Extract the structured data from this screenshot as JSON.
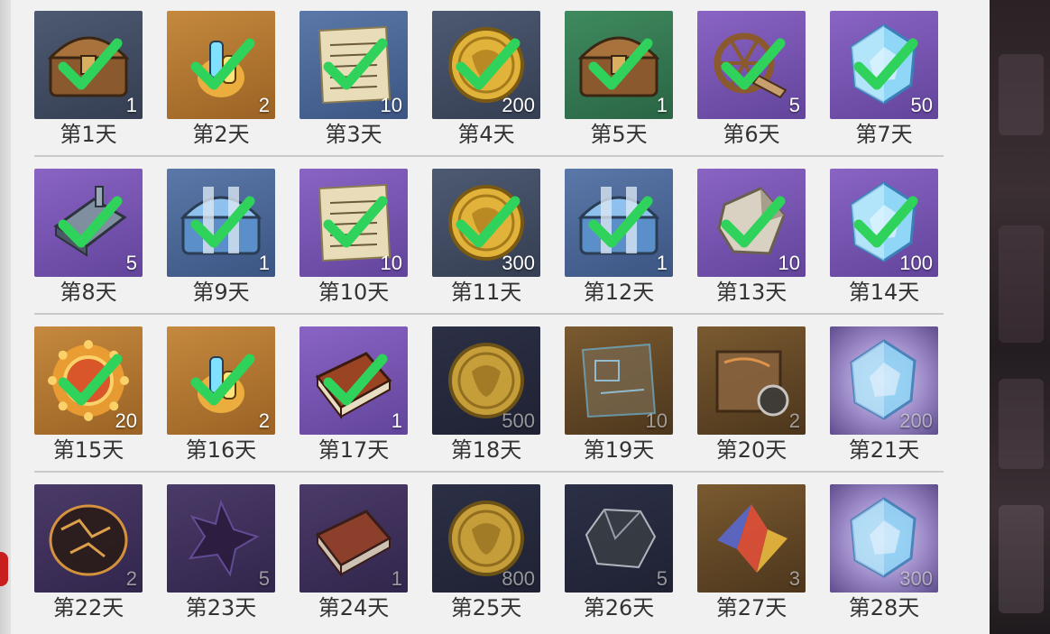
{
  "colors": {
    "check": "#2fd25a",
    "panel": "#f1f1f1",
    "label": "#333333"
  },
  "days": [
    {
      "label": "第1天",
      "qty": "1",
      "item_icon": "chest-icon",
      "bg": "dark",
      "claimed": true
    },
    {
      "label": "第2天",
      "qty": "2",
      "item_icon": "potion-bottles-icon",
      "bg": "orange",
      "claimed": true
    },
    {
      "label": "第3天",
      "qty": "10",
      "item_icon": "scroll-page-icon",
      "bg": "blue",
      "claimed": true
    },
    {
      "label": "第4天",
      "qty": "200",
      "item_icon": "gold-coin-icon",
      "bg": "dark",
      "claimed": true
    },
    {
      "label": "第5天",
      "qty": "1",
      "item_icon": "chest-icon",
      "bg": "green",
      "claimed": true
    },
    {
      "label": "第6天",
      "qty": "5",
      "item_icon": "wheel-part-icon",
      "bg": "purple",
      "claimed": true
    },
    {
      "label": "第7天",
      "qty": "50",
      "item_icon": "blue-crystal-icon",
      "bg": "purple",
      "claimed": true
    },
    {
      "label": "第8天",
      "qty": "5",
      "item_icon": "metal-ingot-icon",
      "bg": "purple",
      "claimed": true
    },
    {
      "label": "第9天",
      "qty": "1",
      "item_icon": "blue-chest-icon",
      "bg": "blue",
      "claimed": true
    },
    {
      "label": "第10天",
      "qty": "10",
      "item_icon": "scroll-page-icon",
      "bg": "purple",
      "claimed": true
    },
    {
      "label": "第11天",
      "qty": "300",
      "item_icon": "gold-coin-icon",
      "bg": "dark",
      "claimed": true
    },
    {
      "label": "第12天",
      "qty": "1",
      "item_icon": "blue-chest-icon",
      "bg": "blue",
      "claimed": true
    },
    {
      "label": "第13天",
      "qty": "10",
      "item_icon": "stone-shard-icon",
      "bg": "purple",
      "claimed": true
    },
    {
      "label": "第14天",
      "qty": "100",
      "item_icon": "blue-crystal-icon",
      "bg": "purple",
      "claimed": true
    },
    {
      "label": "第15天",
      "qty": "20",
      "item_icon": "emblem-icon",
      "bg": "orange",
      "claimed": true
    },
    {
      "label": "第16天",
      "qty": "2",
      "item_icon": "potion-bottles-icon",
      "bg": "orange",
      "claimed": true
    },
    {
      "label": "第17天",
      "qty": "1",
      "item_icon": "book-icon",
      "bg": "purple",
      "claimed": true
    },
    {
      "label": "第18天",
      "qty": "500",
      "item_icon": "gold-coin-icon",
      "bg": "navy",
      "claimed": false
    },
    {
      "label": "第19天",
      "qty": "10",
      "item_icon": "blueprint-icon",
      "bg": "gold",
      "claimed": false
    },
    {
      "label": "第20天",
      "qty": "2",
      "item_icon": "map-scroll-icon",
      "bg": "gold",
      "claimed": false
    },
    {
      "label": "第21天",
      "qty": "200",
      "item_icon": "blue-crystal-icon",
      "bg": "lilac",
      "claimed": false
    },
    {
      "label": "第22天",
      "qty": "2",
      "item_icon": "lava-egg-icon",
      "bg": "violet",
      "claimed": false
    },
    {
      "label": "第23天",
      "qty": "5",
      "item_icon": "dark-crystal-icon",
      "bg": "violet",
      "claimed": false
    },
    {
      "label": "第24天",
      "qty": "1",
      "item_icon": "book-icon",
      "bg": "violet",
      "claimed": false
    },
    {
      "label": "第25天",
      "qty": "800",
      "item_icon": "gold-coin-icon",
      "bg": "navy",
      "claimed": false
    },
    {
      "label": "第26天",
      "qty": "5",
      "item_icon": "ore-rock-icon",
      "bg": "navy",
      "claimed": false
    },
    {
      "label": "第27天",
      "qty": "3",
      "item_icon": "prism-crystal-icon",
      "bg": "gold",
      "claimed": false
    },
    {
      "label": "第28天",
      "qty": "300",
      "item_icon": "blue-crystal-icon",
      "bg": "lilac",
      "claimed": false
    }
  ]
}
